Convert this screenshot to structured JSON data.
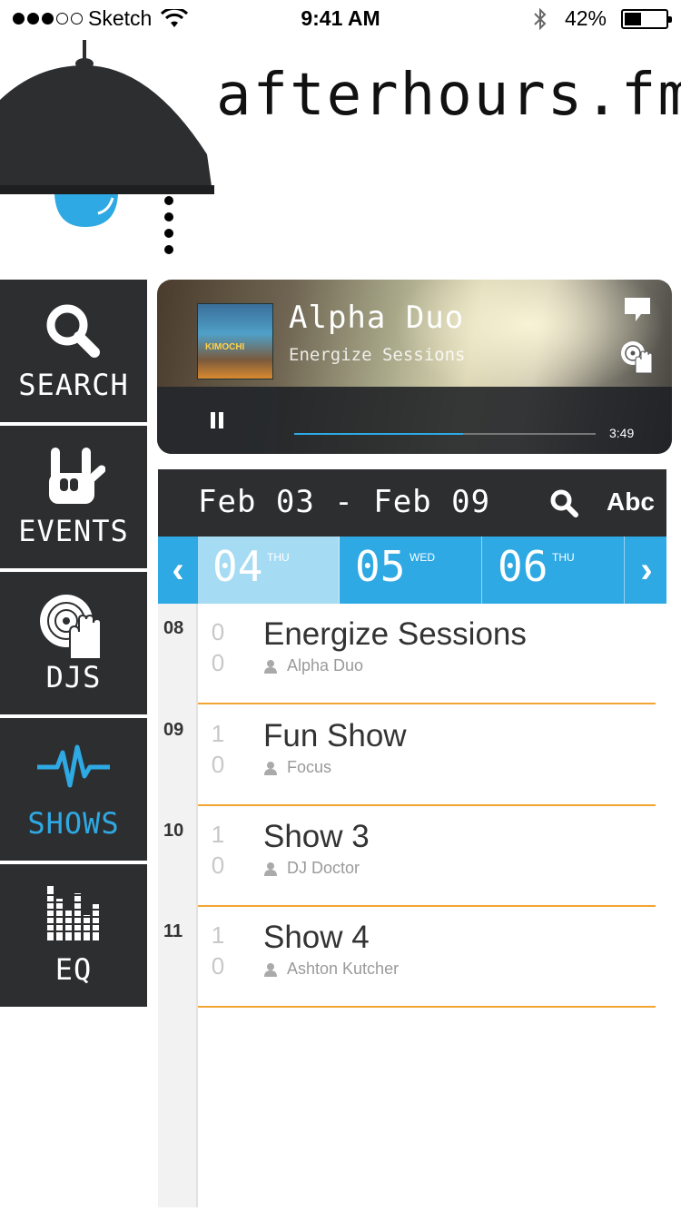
{
  "status_bar": {
    "carrier": "Sketch",
    "time": "9:41 AM",
    "battery": "42%",
    "battery_level": 0.42
  },
  "header": {
    "brand": "afterhours.fm",
    "icons": {
      "lamp": "lamp-icon"
    }
  },
  "sidebar": {
    "items": [
      {
        "label": "SEARCH",
        "icon": "search-icon",
        "active": false
      },
      {
        "label": "EVENTS",
        "icon": "rock-hand-icon",
        "active": false
      },
      {
        "label": "DJS",
        "icon": "turntable-hand-icon",
        "active": false
      },
      {
        "label": "SHOWS",
        "icon": "pulse-icon",
        "active": true
      },
      {
        "label": "EQ",
        "icon": "equalizer-icon",
        "active": false
      }
    ],
    "accent": "#2ea9e3"
  },
  "player": {
    "artist": "Alpha Duo",
    "show": "Energize Sessions",
    "album_text": "KIMOCHI",
    "time": "3:49",
    "progress": 0.56
  },
  "schedule": {
    "range": "Feb 03 - Feb 09",
    "sort_label": "Abc",
    "days": [
      {
        "num": "04",
        "weekday": "THU",
        "selected": true
      },
      {
        "num": "05",
        "weekday": "WED",
        "selected": false
      },
      {
        "num": "06",
        "weekday": "THU",
        "selected": false
      }
    ],
    "prev": "‹",
    "next": "›",
    "shows": [
      {
        "hour": "08",
        "min1": "0",
        "min2": "0",
        "title": "Energize Sessions",
        "host": "Alpha Duo"
      },
      {
        "hour": "09",
        "min1": "1",
        "min2": "0",
        "title": "Fun Show",
        "host": "Focus"
      },
      {
        "hour": "10",
        "min1": "1",
        "min2": "0",
        "title": "Show 3",
        "host": "DJ Doctor"
      },
      {
        "hour": "11",
        "min1": "1",
        "min2": "0",
        "title": "Show 4",
        "host": "Ashton Kutcher"
      }
    ],
    "separator_color": "#f2a531"
  }
}
